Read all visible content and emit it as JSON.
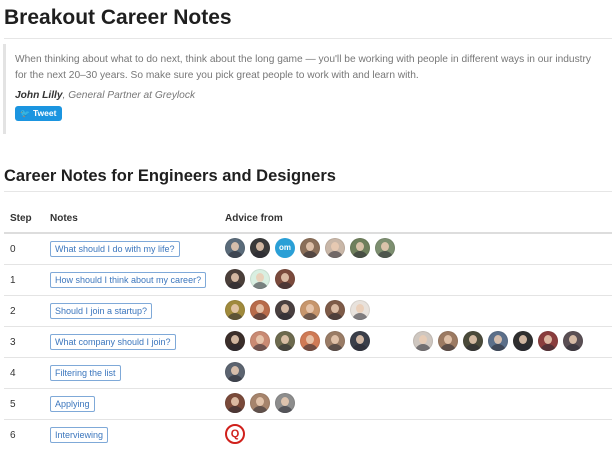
{
  "page": {
    "title": "Breakout Career Notes"
  },
  "quote": {
    "text": "When thinking about what to do next, think about the long game — you'll be working with people in different ways in our industry for the next 20–30 years. So make sure you pick great people to work with and learn with.",
    "author": "John Lilly",
    "role": ", General Partner at Greylock",
    "tweet_label": "Tweet",
    "tweet_icon": "twitter-bird-icon"
  },
  "section": {
    "title": "Career Notes for Engineers and Designers"
  },
  "table": {
    "headers": [
      "Step",
      "Notes",
      "Advice from"
    ],
    "rows": [
      {
        "step": "0",
        "note": "What should I do with my life?",
        "avatars": [
          "#5a6b7a",
          "#3a3a3a",
          "om",
          "#8a6e58",
          "#c9b7a8",
          "#6f7f5c",
          "#7d8f70"
        ]
      },
      {
        "step": "1",
        "note": "How should I think about my career?",
        "avatars": [
          "#4b3f3a",
          "#d9efe1",
          "#7b4a3c"
        ]
      },
      {
        "step": "2",
        "note": "Should I join a startup?",
        "avatars": [
          "#a08a3c",
          "#b86b4a",
          "#4a4040",
          "#c7966c",
          "#7e5b48",
          "#e8e2dc"
        ]
      },
      {
        "step": "3",
        "note": "What company should I join?",
        "avatars": [
          "#3b2e2a",
          "#c98a73",
          "#6d6a4e",
          "#cf7a55",
          "#9a7c66",
          "#3a3f4a",
          "#cfc7c0",
          "#9c7a62",
          "#4a4a3a",
          "#5b6f8a",
          "#2f2f2f",
          "#8a3d3d",
          "#5a4f54"
        ]
      },
      {
        "step": "4",
        "note": "Filtering the list",
        "avatars": [
          "#5c6470"
        ]
      },
      {
        "step": "5",
        "note": "Applying",
        "avatars": [
          "#7a4a3a",
          "#a6846c",
          "#8d8d8d"
        ]
      },
      {
        "step": "6",
        "note": "Interviewing",
        "avatars": [
          "Q"
        ]
      }
    ]
  }
}
